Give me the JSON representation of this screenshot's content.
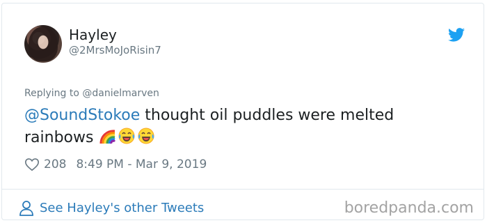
{
  "tweet": {
    "display_name": "Hayley",
    "handle": "@2MrsMoJoRisin7",
    "replying_label": "Replying to @danielmarven",
    "mention": "@SoundStokoe",
    "text_line1_rest": " thought oil puddles were melted",
    "text_line2": "rainbows ",
    "emojis": [
      "rainbow-emoji",
      "tears-of-joy-emoji",
      "tears-of-joy-emoji"
    ],
    "likes": "208",
    "timestamp": "8:49 PM - Mar 9, 2019"
  },
  "footer": {
    "see_more_label": "See Hayley's other Tweets",
    "watermark": "boredpanda.com"
  },
  "colors": {
    "link": "#2b7bb9",
    "muted": "#697882",
    "twitter_blue": "#1da1f2",
    "border": "#e1e8ed"
  }
}
